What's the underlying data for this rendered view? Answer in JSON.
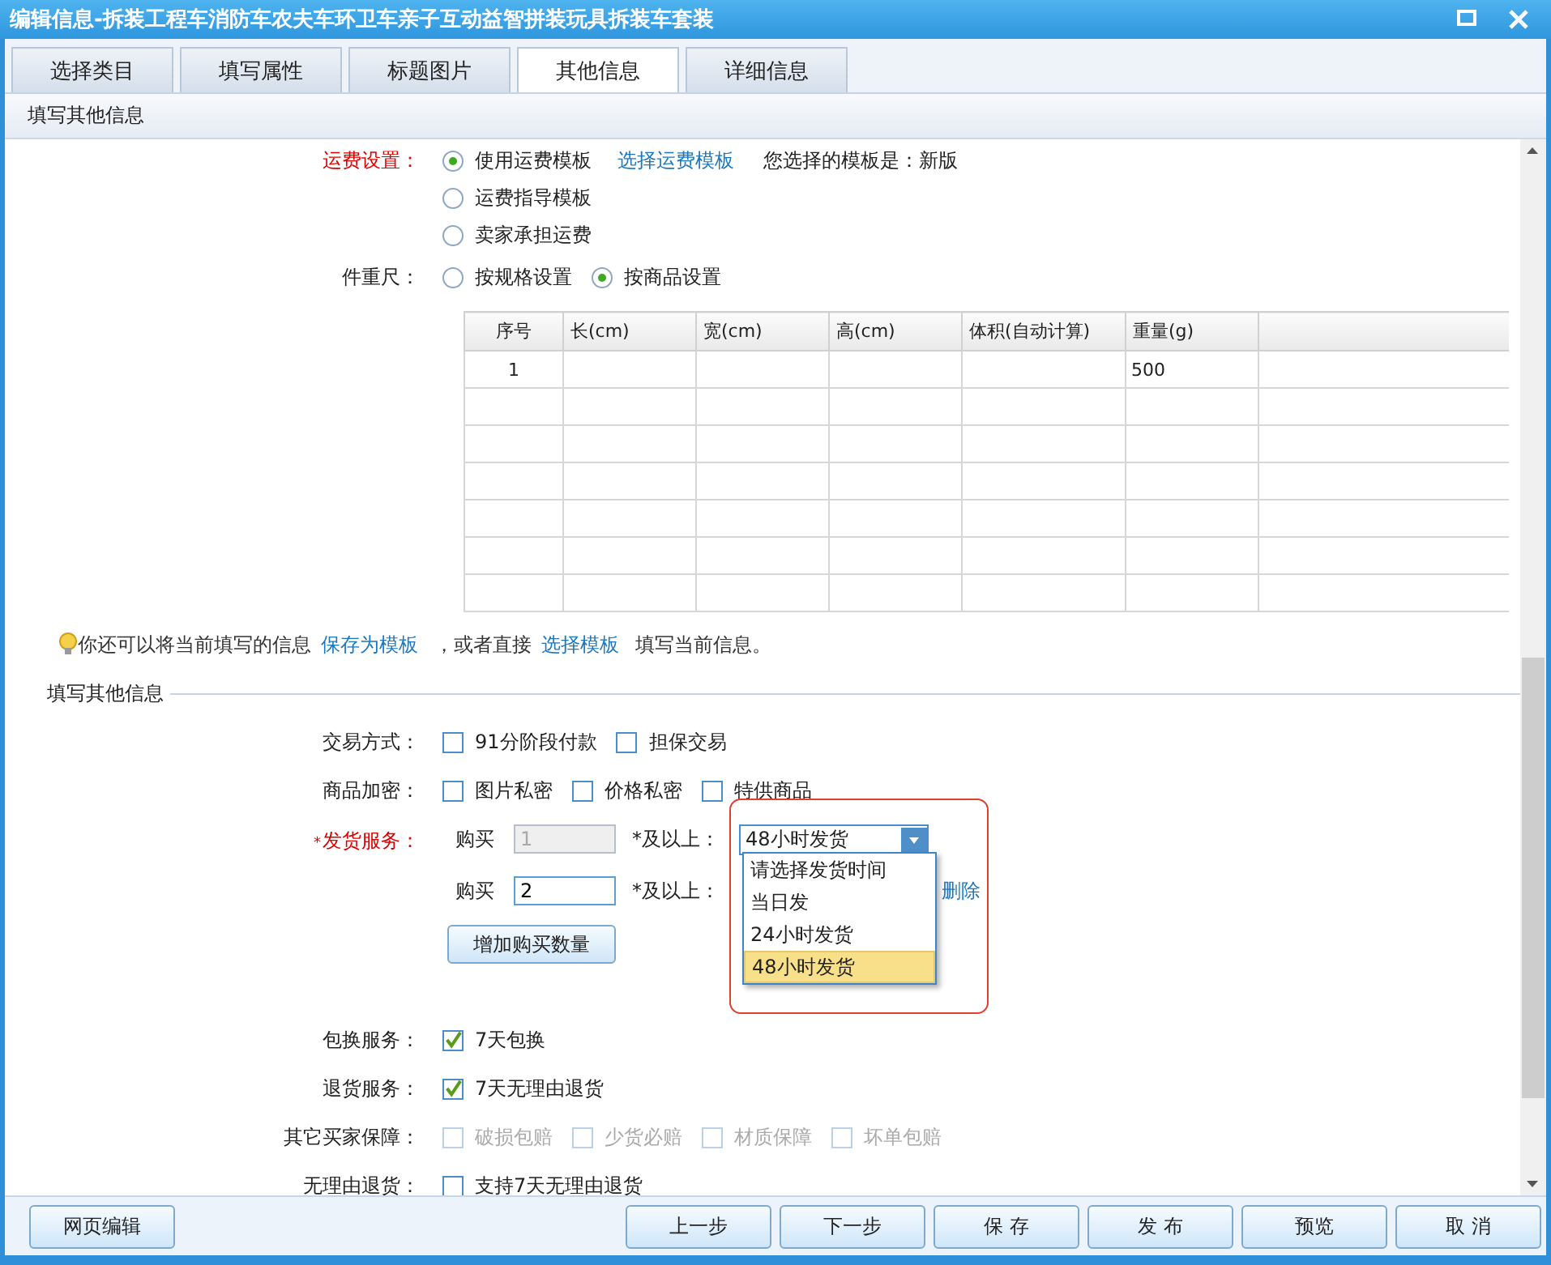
{
  "window": {
    "title": "编辑信息-拆装工程车消防车农夫车环卫车亲子互动益智拼装玩具拆装车套装"
  },
  "tabs": [
    {
      "label": "选择类目",
      "selected": false
    },
    {
      "label": "填写属性",
      "selected": false
    },
    {
      "label": "标题图片",
      "selected": false
    },
    {
      "label": "其他信息",
      "selected": true
    },
    {
      "label": "详细信息",
      "selected": false
    }
  ],
  "subheader": "填写其他信息",
  "freight": {
    "label": "运费设置：",
    "link": "选择运费模板",
    "note": "您选择的模板是：新版",
    "options": [
      {
        "label": "使用运费模板",
        "selected": true
      },
      {
        "label": "运费指导模板",
        "selected": false
      },
      {
        "label": "卖家承担运费",
        "selected": false
      }
    ]
  },
  "size_weight": {
    "label": "件重尺：",
    "options": [
      {
        "label": "按规格设置",
        "selected": false
      },
      {
        "label": "按商品设置",
        "selected": true
      }
    ]
  },
  "table": {
    "columns": [
      "序号",
      "长(cm)",
      "宽(cm)",
      "高(cm)",
      "体积(自动计算)",
      "重量(g)"
    ],
    "rows": [
      {
        "index": "1",
        "weight": "500"
      }
    ]
  },
  "tip": [
    {
      "kind": "text",
      "text": "你还可以将当前填写的信息"
    },
    {
      "kind": "link",
      "text": "保存为模板"
    },
    {
      "kind": "text",
      "text": "，或者直接"
    },
    {
      "kind": "link",
      "text": "选择模板"
    },
    {
      "kind": "text",
      "text": "填写当前信息。"
    }
  ],
  "other_info": {
    "title": "填写其他信息",
    "fields": [
      {
        "kind": "checks",
        "label": "交易方式：",
        "options": [
          {
            "label": "91分阶段付款",
            "checked": false,
            "disabled": false
          },
          {
            "label": "担保交易",
            "checked": false,
            "disabled": false
          }
        ]
      },
      {
        "kind": "checks",
        "label": "商品加密：",
        "options": [
          {
            "label": "图片私密",
            "checked": false,
            "disabled": false
          },
          {
            "label": "价格私密",
            "checked": false,
            "disabled": false
          },
          {
            "label": "特供商品",
            "checked": false,
            "disabled": false
          }
        ]
      },
      {
        "kind": "shipping",
        "label": "发货服务：",
        "required_mark": "*",
        "tiers": [
          {
            "prefix": "购买",
            "qty": "1",
            "disabled": true,
            "suffix": "*及以上：",
            "select": "48小时发货"
          },
          {
            "prefix": "购买",
            "qty": "2",
            "disabled": false,
            "suffix": "*及以上：",
            "delete_link": "删除"
          }
        ],
        "add_button": "增加购买数量",
        "dropdown": [
          {
            "label": "请选择发货时间",
            "selected": false
          },
          {
            "label": "当日发",
            "selected": false
          },
          {
            "label": "24小时发货",
            "selected": false
          },
          {
            "label": "48小时发货",
            "selected": true
          }
        ]
      },
      {
        "kind": "checks",
        "label": "包换服务：",
        "options": [
          {
            "label": "7天包换",
            "checked": true,
            "disabled": false
          }
        ]
      },
      {
        "kind": "checks",
        "label": "退货服务：",
        "options": [
          {
            "label": "7天无理由退货",
            "checked": true,
            "disabled": false
          }
        ]
      },
      {
        "kind": "checks",
        "label": "其它买家保障：",
        "options": [
          {
            "label": "破损包赔",
            "checked": false,
            "disabled": true
          },
          {
            "label": "少货必赔",
            "checked": false,
            "disabled": true
          },
          {
            "label": "材质保障",
            "checked": false,
            "disabled": true
          },
          {
            "label": "坏单包赔",
            "checked": false,
            "disabled": true
          }
        ]
      },
      {
        "kind": "checks",
        "label": "无理由退货：",
        "options": [
          {
            "label": "支持7天无理由退货",
            "checked": false,
            "disabled": false
          }
        ]
      }
    ]
  },
  "footer": {
    "left_button": "网页编辑",
    "buttons": [
      "上一步",
      "下一步",
      "保 存",
      "发 布",
      "预览",
      "取 消"
    ]
  }
}
